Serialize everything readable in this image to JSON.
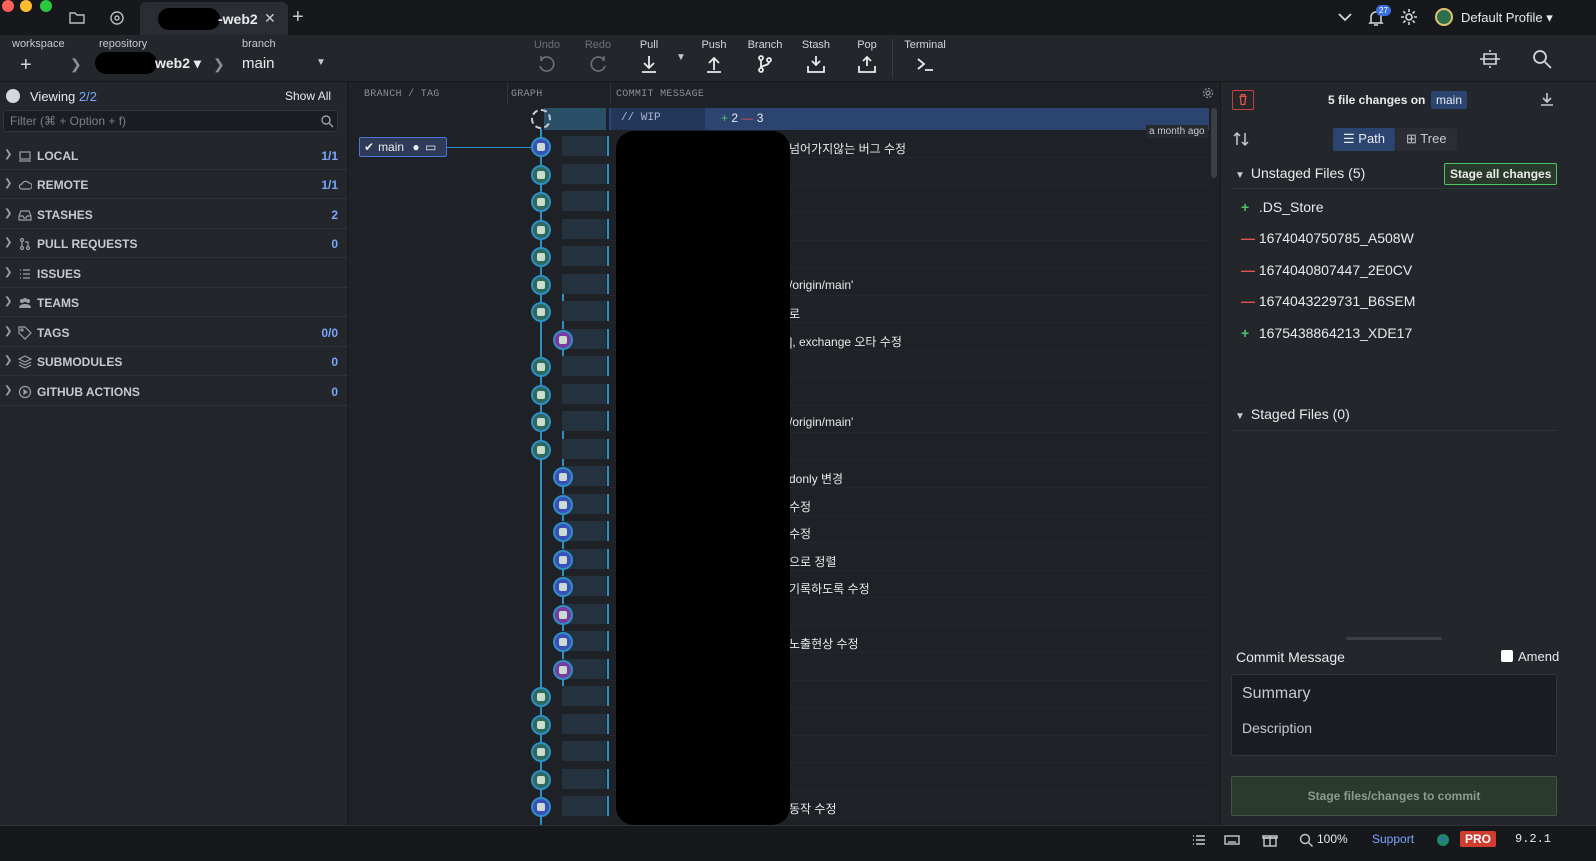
{
  "titlebar": {
    "tab_name": "-web2",
    "notification_count": "27",
    "profile_name": "Default Profile"
  },
  "toolbar": {
    "workspace_label": "workspace",
    "repository_label": "repository",
    "repository_name": "web2",
    "branch_label": "branch",
    "branch_name": "main",
    "actions": {
      "undo": "Undo",
      "redo": "Redo",
      "pull": "Pull",
      "push": "Push",
      "branch": "Branch",
      "stash": "Stash",
      "pop": "Pop",
      "terminal": "Terminal"
    }
  },
  "left": {
    "viewing_label": "Viewing",
    "viewing_count": "2/2",
    "show_all": "Show All",
    "filter_placeholder": "Filter (⌘ + Option + f)",
    "sections": [
      {
        "label": "LOCAL",
        "count": "1/1"
      },
      {
        "label": "REMOTE",
        "count": "1/1"
      },
      {
        "label": "STASHES",
        "count": "2"
      },
      {
        "label": "PULL REQUESTS",
        "count": "0"
      },
      {
        "label": "ISSUES",
        "count": ""
      },
      {
        "label": "TEAMS",
        "count": ""
      },
      {
        "label": "TAGS",
        "count": "0/0"
      },
      {
        "label": "SUBMODULES",
        "count": "0"
      },
      {
        "label": "GITHUB ACTIONS",
        "count": "0"
      }
    ]
  },
  "graph": {
    "col_branch_tag": "BRANCH / TAG",
    "col_graph": "GRAPH",
    "col_commit_message": "COMMIT MESSAGE",
    "wip_label": "// WIP",
    "wip_added": "2",
    "wip_removed": "3",
    "branch_tag": "main",
    "time_ago": "a month ago",
    "messages": [
      "넘어가지않는 버그 수정",
      "",
      "",
      "",
      "",
      "/origin/main'",
      "로",
      "], exchange 오타 수정",
      "",
      "",
      "/origin/main'",
      "",
      "donly 변경",
      "수정",
      "수정",
      "으로 정렬",
      " 기록하도록 수정",
      "",
      "노출현상 수정",
      "",
      "",
      "",
      "",
      "",
      "동작 수정"
    ]
  },
  "right": {
    "file_changes_text": "5 file changes on",
    "branch": "main",
    "view_path": "Path",
    "view_tree": "Tree",
    "unstaged_header": "Unstaged Files (5)",
    "stage_all": "Stage all changes",
    "unstaged_files": [
      {
        "name": ".DS_Store",
        "status": "added"
      },
      {
        "name": "1674040750785_A508W",
        "status": "deleted"
      },
      {
        "name": "1674040807447_2E0CV",
        "status": "deleted"
      },
      {
        "name": "1674043229731_B6SEM",
        "status": "deleted"
      },
      {
        "name": "1675438864213_XDE17",
        "status": "added"
      }
    ],
    "staged_header": "Staged Files (0)",
    "commit_message_title": "Commit Message",
    "amend_label": "Amend",
    "summary_placeholder": "Summary",
    "description_placeholder": "Description",
    "commit_button": "Stage files/changes to commit"
  },
  "statusbar": {
    "zoom": "100%",
    "support": "Support",
    "pro": "PRO",
    "version": "9.2.1"
  }
}
